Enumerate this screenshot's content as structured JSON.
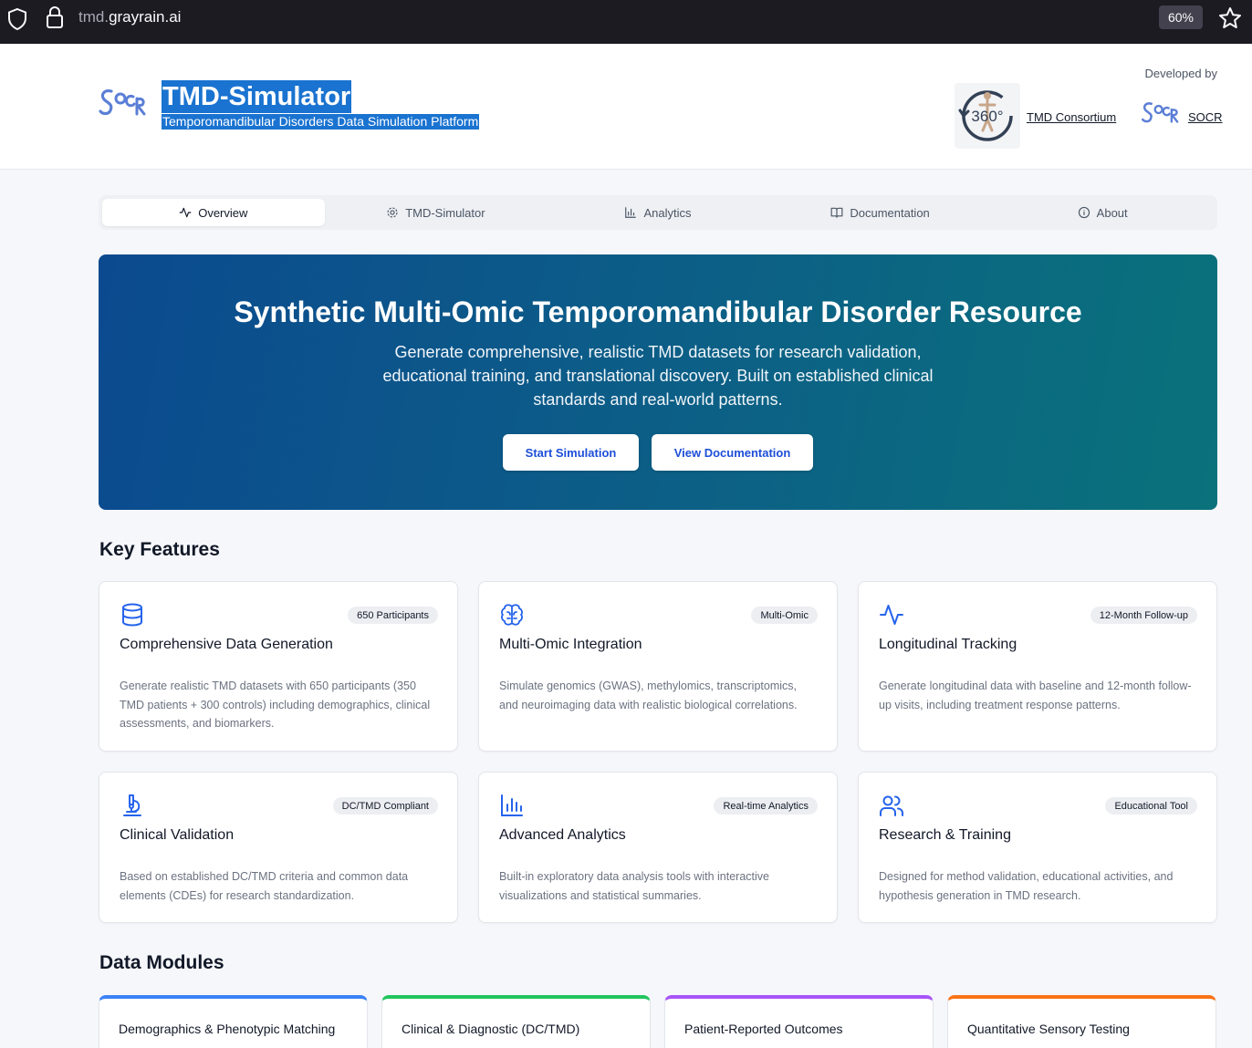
{
  "browser": {
    "url_domain_dim": "tmd.",
    "url_domain": "grayrain.ai",
    "zoom": "60%"
  },
  "header": {
    "title": "TMD-Simulator",
    "subtitle": "Temporomandibular Disorders Data Simulation Platform",
    "developed_by": "Developed by",
    "link_tmd": "TMD Consortium",
    "link_socr": "SOCR"
  },
  "tabs": [
    {
      "label": "Overview",
      "icon": "activity-icon",
      "active": true
    },
    {
      "label": "TMD-Simulator",
      "icon": "gear-icon"
    },
    {
      "label": "Analytics",
      "icon": "bar-chart-icon"
    },
    {
      "label": "Documentation",
      "icon": "book-icon"
    },
    {
      "label": "About",
      "icon": "info-icon"
    }
  ],
  "hero": {
    "title": "Synthetic Multi-Omic Temporomandibular Disorder Resource",
    "description": "Generate comprehensive, realistic TMD datasets for research validation, educational training, and translational discovery. Built on established clinical standards and real-world patterns.",
    "start_button": "Start Simulation",
    "docs_button": "View Documentation"
  },
  "features": {
    "heading": "Key Features",
    "cards": [
      {
        "icon": "database-icon",
        "badge": "650 Participants",
        "title": "Comprehensive Data Generation",
        "description": "Generate realistic TMD datasets with 650 participants (350 TMD patients + 300 controls) including demographics, clinical assessments, and biomarkers."
      },
      {
        "icon": "brain-icon",
        "badge": "Multi-Omic",
        "title": "Multi-Omic Integration",
        "description": "Simulate genomics (GWAS), methylomics, transcriptomics, and neuroimaging data with realistic biological correlations."
      },
      {
        "icon": "activity-icon",
        "badge": "12-Month Follow-up",
        "title": "Longitudinal Tracking",
        "description": "Generate longitudinal data with baseline and 12-month follow-up visits, including treatment response patterns."
      },
      {
        "icon": "microscope-icon",
        "badge": "DC/TMD Compliant",
        "title": "Clinical Validation",
        "description": "Based on established DC/TMD criteria and common data elements (CDEs) for research standardization."
      },
      {
        "icon": "bar-chart-icon",
        "badge": "Real-time Analytics",
        "title": "Advanced Analytics",
        "description": "Built-in exploratory data analysis tools with interactive visualizations and statistical summaries."
      },
      {
        "icon": "users-icon",
        "badge": "Educational Tool",
        "title": "Research & Training",
        "description": "Designed for method validation, educational activities, and hypothesis generation in TMD research."
      }
    ]
  },
  "modules": {
    "heading": "Data Modules",
    "items": [
      {
        "title": "Demographics & Phenotypic Matching",
        "color": "#3b82f6"
      },
      {
        "title": "Clinical & Diagnostic (DC/TMD)",
        "color": "#22c55e"
      },
      {
        "title": "Patient-Reported Outcomes",
        "color": "#a855f7"
      },
      {
        "title": "Quantitative Sensory Testing",
        "color": "#f97316"
      }
    ]
  },
  "colors": {
    "accent": "#2563eb",
    "hero_start": "#0b4a8f",
    "hero_end": "#0a727b"
  }
}
